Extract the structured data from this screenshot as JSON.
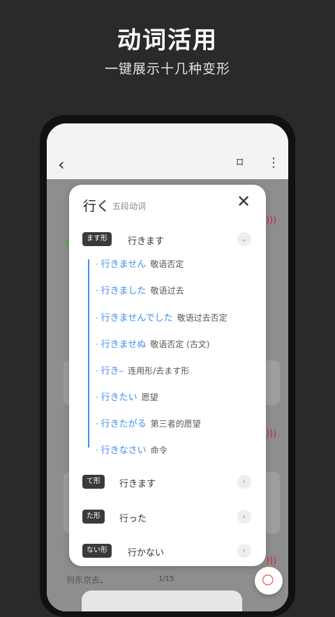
{
  "header": {
    "title": "动词活用",
    "subtitle": "一键展示十几种变形"
  },
  "appbar": {
    "back_icon": "‹",
    "speaker_icon": "⌑",
    "more_icon": "⋮"
  },
  "popup": {
    "word": "行く",
    "word_type": "五段动词",
    "close_icon": "✕",
    "masu_form": {
      "badge": "ます形",
      "value": "行きます",
      "chevron": "⌄",
      "sub_forms": [
        {
          "dot": "·",
          "form": "行きません",
          "meaning": "敬语否定"
        },
        {
          "dot": "·",
          "form": "行きました",
          "meaning": "敬语过去"
        },
        {
          "dot": "·",
          "form": "行きませんでした",
          "meaning": "敬语过去否定"
        },
        {
          "dot": "·",
          "form": "行きませぬ",
          "meaning": "敬语否定 (古文)"
        },
        {
          "dot": "·",
          "form": "行き–",
          "meaning": "连用形/去ます形"
        },
        {
          "dot": "·",
          "form": "行きたい",
          "meaning": "愿望"
        },
        {
          "dot": "·",
          "form": "行きたがる",
          "meaning": "第三者的愿望"
        },
        {
          "dot": "·",
          "form": "行きなさい",
          "meaning": "命令"
        }
      ]
    },
    "other_forms": [
      {
        "badge": "て形",
        "value": "行きます",
        "chevron": "›"
      },
      {
        "badge": "た形",
        "value": "行った",
        "chevron": "›"
      },
      {
        "badge": "ない形",
        "value": "行かない",
        "chevron": "›"
      }
    ]
  },
  "background": {
    "bottom_text": "到东京去。",
    "page_indicator": "1/15"
  },
  "colors": {
    "accent_blue": "#3e8ff0",
    "badge_dark": "#3a3a3a",
    "fab_red": "#e0523f"
  }
}
